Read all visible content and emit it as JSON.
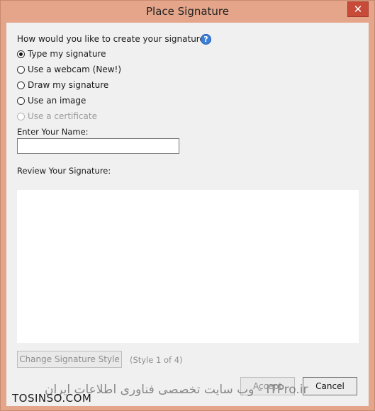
{
  "window": {
    "title": "Place Signature",
    "close_glyph": "✕"
  },
  "question": {
    "text": "How would you like to create your signature?",
    "help_icon": "?"
  },
  "options": [
    {
      "label": "Type my signature",
      "checked": true,
      "disabled": false
    },
    {
      "label": "Use a webcam (New!)",
      "checked": false,
      "disabled": false
    },
    {
      "label": "Draw my signature",
      "checked": false,
      "disabled": false
    },
    {
      "label": "Use an image",
      "checked": false,
      "disabled": false
    },
    {
      "label": "Use a certificate",
      "checked": false,
      "disabled": true
    }
  ],
  "name_field": {
    "label": "Enter Your Name:",
    "value": ""
  },
  "review": {
    "label": "Review Your Signature:"
  },
  "style_controls": {
    "change_label": "Change Signature Style",
    "style_indicator": "(Style 1 of 4)"
  },
  "footer": {
    "accept_label": "Accept",
    "cancel_label": "Cancel"
  },
  "watermark": {
    "site": "TOSINSO.COM",
    "persian": "ITPro.ir - وب سایت تخصصی فناوری اطلاعات ایران"
  },
  "colors": {
    "frame": "#e4a58a",
    "close_button": "#c84a39",
    "help_icon": "#3d7ed8",
    "dialog_bg": "#f0f0f0"
  }
}
